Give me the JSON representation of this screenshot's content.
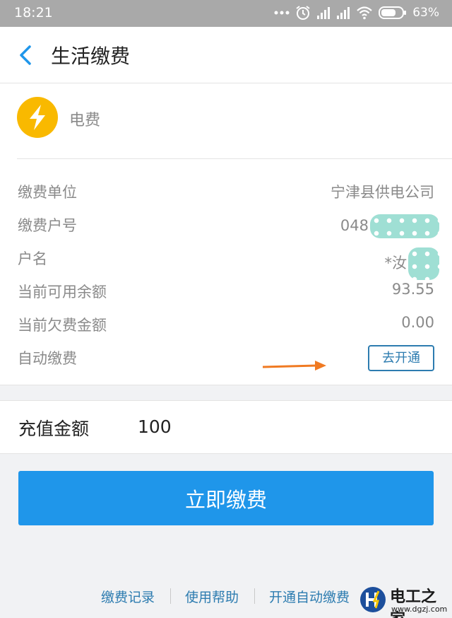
{
  "status_bar": {
    "time": "18:21",
    "battery": "63%",
    "icons": [
      "more-dots-icon",
      "alarm-icon",
      "signal-icon",
      "signal-icon",
      "wifi-icon",
      "battery-icon"
    ]
  },
  "header": {
    "title": "生活缴费",
    "back_icon": "chevron-left-icon"
  },
  "bill": {
    "icon": "lightning-bolt-icon",
    "icon_color": "#f9b900",
    "type": "电费"
  },
  "details": [
    {
      "label": "缴费单位",
      "value": "宁津县供电公司"
    },
    {
      "label": "缴费户号",
      "value": "048"
    },
    {
      "label": "户名",
      "value": "*汝"
    },
    {
      "label": "当前可用余额",
      "value": "93.55"
    },
    {
      "label": "当前欠费金额",
      "value": "0.00"
    },
    {
      "label": "自动缴费",
      "action": "去开通"
    }
  ],
  "amount": {
    "label": "充值金额",
    "value": "100"
  },
  "pay_button": {
    "label": "立即缴费",
    "color": "#1f96ea"
  },
  "footer": {
    "links": [
      "缴费记录",
      "使用帮助",
      "开通自动缴费"
    ]
  },
  "watermark": {
    "title": "电工之家",
    "url": "www.dgzj.com"
  },
  "colors": {
    "accent_blue": "#1f96ea",
    "link_blue": "#2d7cb0",
    "annotation_arrow": "#f07a22"
  }
}
